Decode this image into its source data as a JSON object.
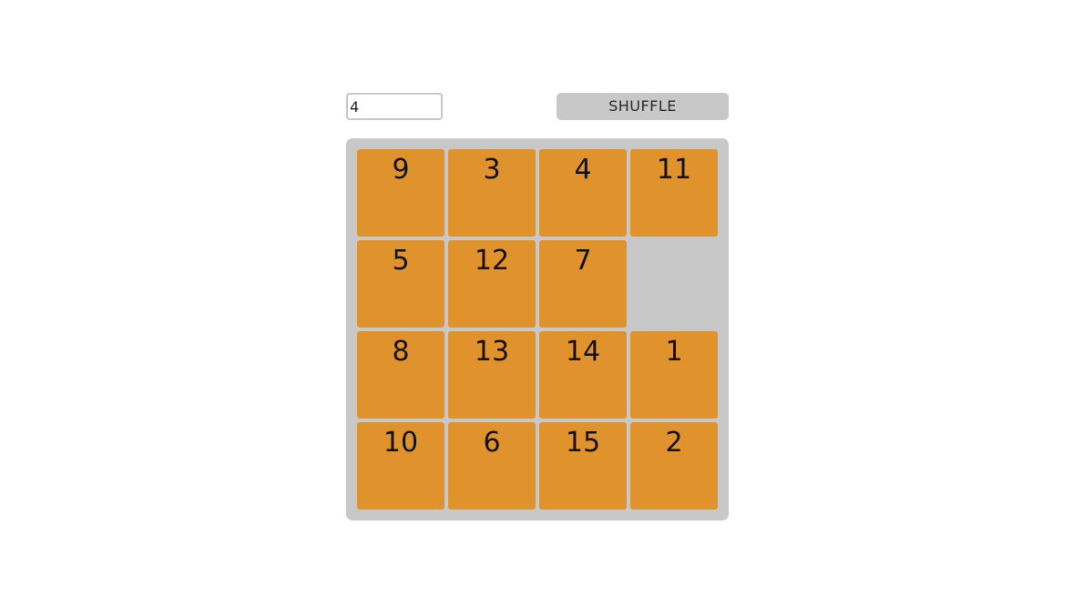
{
  "controls": {
    "size_value": "4",
    "shuffle_label": "SHUFFLE"
  },
  "board": {
    "size": 4,
    "tiles": [
      [
        "9",
        "3",
        "4",
        "11"
      ],
      [
        "5",
        "12",
        "7",
        ""
      ],
      [
        "8",
        "13",
        "14",
        "1"
      ],
      [
        "10",
        "6",
        "15",
        "2"
      ]
    ]
  },
  "colors": {
    "tile": "#e0922c",
    "board": "#c8c8c8",
    "button": "#c8c8c8"
  }
}
